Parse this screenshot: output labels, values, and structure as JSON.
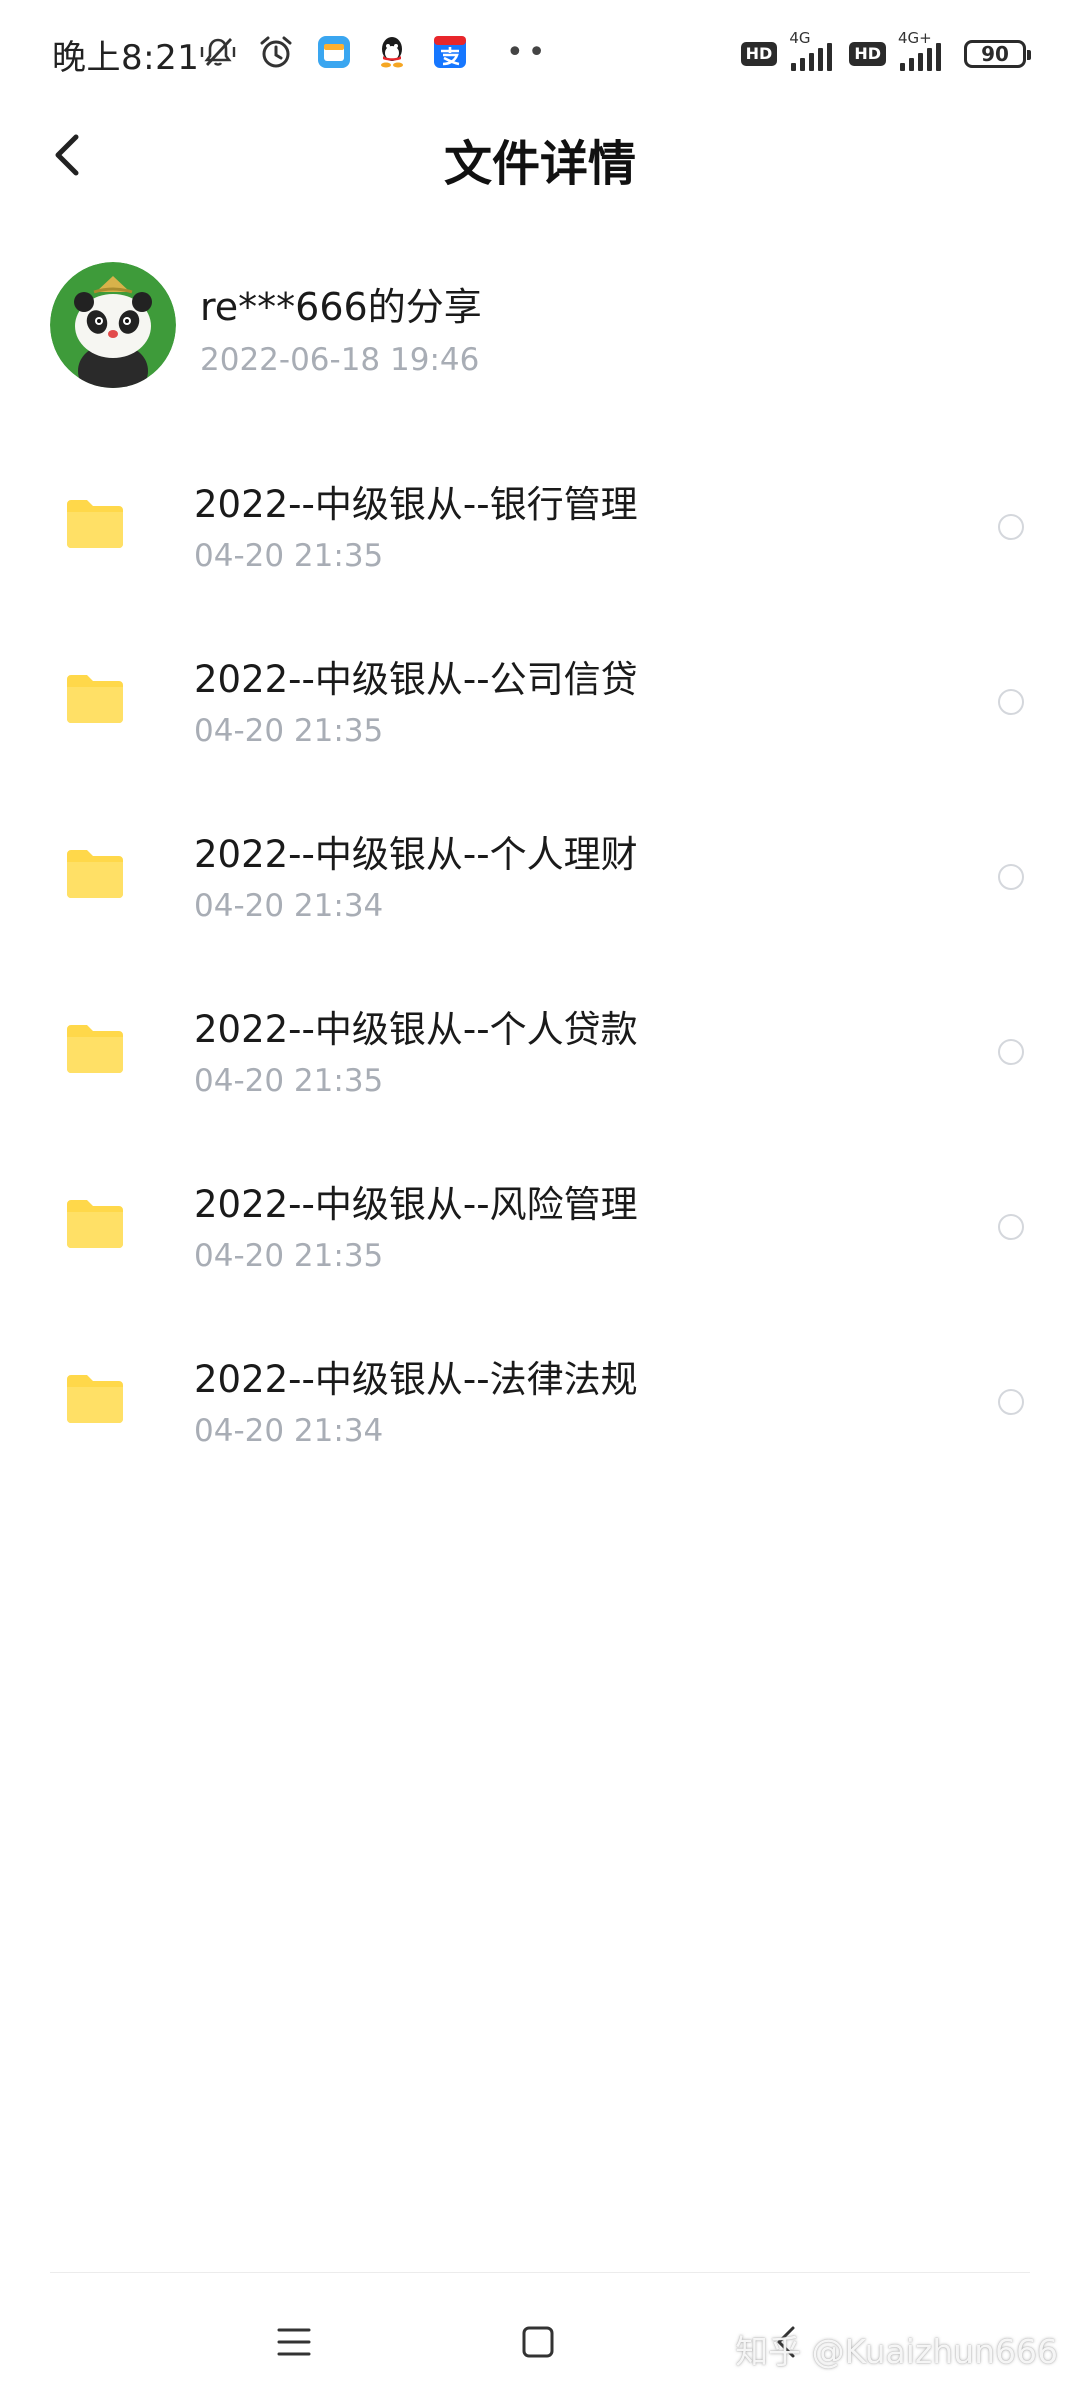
{
  "status_bar": {
    "time": "晚上8:21",
    "network_1": "4G",
    "network_2": "4G+",
    "hd_label": "HD",
    "battery": "90"
  },
  "header": {
    "title": "文件详情"
  },
  "share": {
    "title": "re***666的分享",
    "date": "2022-06-18  19:46"
  },
  "files": [
    {
      "name": "2022--中级银从--银行管理",
      "time": "04-20  21:35"
    },
    {
      "name": "2022--中级银从--公司信贷",
      "time": "04-20  21:35"
    },
    {
      "name": "2022--中级银从--个人理财",
      "time": "04-20  21:34"
    },
    {
      "name": "2022--中级银从--个人贷款",
      "time": "04-20  21:35"
    },
    {
      "name": "2022--中级银从--风险管理",
      "time": "04-20  21:35"
    },
    {
      "name": "2022--中级银从--法律法规",
      "time": "04-20  21:34"
    }
  ],
  "watermark": "知乎 @Kuaizhun666",
  "colors": {
    "folder": "#ffd84a",
    "secondary_text": "#a8adb5",
    "avatar_bg": "#3e9b3a"
  },
  "icons": {
    "status_left": [
      "mute-vibrate-icon",
      "alarm-icon",
      "calendar-app-icon",
      "qq-icon",
      "alipay-icon"
    ],
    "nav": [
      "menu-icon",
      "home-icon",
      "back-icon"
    ]
  }
}
